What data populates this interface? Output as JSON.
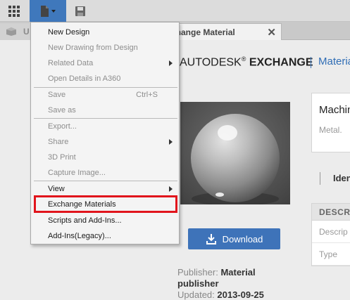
{
  "toolbar": {
    "grid_icon": "grid-icon",
    "file_icon": "file-icon",
    "save_icon": "save-icon",
    "accent": "#3f78bc"
  },
  "tabs": {
    "background_tab_prefix": "U",
    "active_tab_label": "change Material",
    "close_symbol": "✕"
  },
  "page": {
    "brand_autodesk": "AUTODESK",
    "brand_reg": "®",
    "brand_exchange": "EXCHANGE",
    "brand_link": "Materia",
    "download_label": "Download",
    "publisher_label": "Publisher:",
    "publisher_value": "Material publisher",
    "updated_label": "Updated:",
    "updated_value": "2013-09-25",
    "card_title": "Machin",
    "card_subtitle": "Metal.",
    "identity_label": "Iden",
    "table_header": "DESCR",
    "table_row1": "Descrip",
    "table_row2": "Type"
  },
  "menu": {
    "items": [
      {
        "label": "New Design",
        "shortcut": "",
        "submenu": false,
        "enabled": true
      },
      {
        "label": "New Drawing from Design",
        "shortcut": "",
        "submenu": false,
        "enabled": false
      },
      {
        "label": "Related Data",
        "shortcut": "",
        "submenu": true,
        "enabled": false
      },
      {
        "label": "Open Details in A360",
        "shortcut": "",
        "submenu": false,
        "enabled": false
      },
      {
        "label": "Save",
        "shortcut": "Ctrl+S",
        "submenu": false,
        "enabled": false
      },
      {
        "label": "Save as",
        "shortcut": "",
        "submenu": false,
        "enabled": false
      },
      {
        "label": "Export...",
        "shortcut": "",
        "submenu": false,
        "enabled": false
      },
      {
        "label": "Share",
        "shortcut": "",
        "submenu": true,
        "enabled": false
      },
      {
        "label": "3D Print",
        "shortcut": "",
        "submenu": false,
        "enabled": false
      },
      {
        "label": "Capture Image...",
        "shortcut": "",
        "submenu": false,
        "enabled": false
      },
      {
        "label": "View",
        "shortcut": "",
        "submenu": true,
        "enabled": true
      },
      {
        "label": "Exchange Materials",
        "shortcut": "",
        "submenu": false,
        "enabled": true
      },
      {
        "label": "Scripts and Add-Ins...",
        "shortcut": "",
        "submenu": false,
        "enabled": true
      },
      {
        "label": "Add-Ins(Legacy)...",
        "shortcut": "",
        "submenu": false,
        "enabled": true
      }
    ],
    "highlight_color": "#e1141c"
  }
}
